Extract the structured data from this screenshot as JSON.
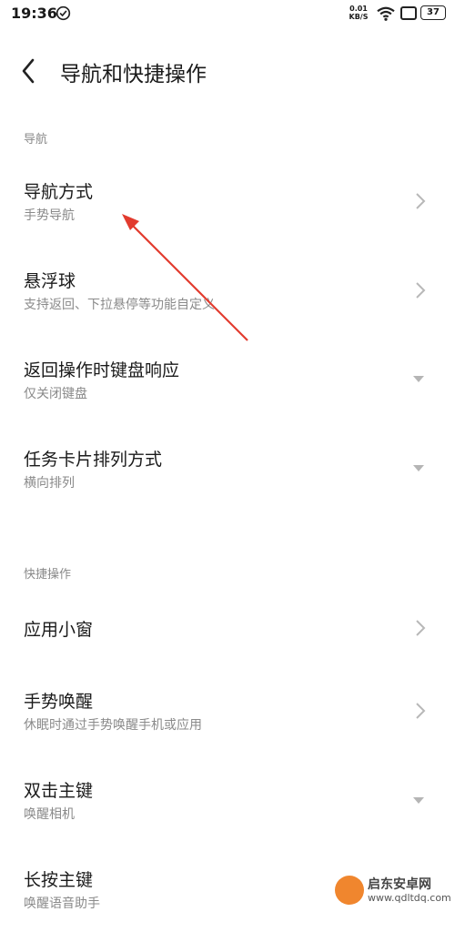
{
  "status": {
    "time": "19:36",
    "net_speed_value": "0.01",
    "net_speed_unit": "KB/S",
    "battery": "37",
    "icons": [
      "check-circle-icon",
      "wifi-icon",
      "window-icon",
      "battery-icon"
    ]
  },
  "header": {
    "back_icon": "chevron-left-icon",
    "title": "导航和快捷操作"
  },
  "sections": [
    {
      "label": "导航",
      "items": [
        {
          "title": "导航方式",
          "subtitle": "手势导航",
          "control": "chevron"
        },
        {
          "title": "悬浮球",
          "subtitle": "支持返回、下拉悬停等功能自定义",
          "control": "chevron"
        },
        {
          "title": "返回操作时键盘响应",
          "subtitle": "仅关闭键盘",
          "control": "dropdown"
        },
        {
          "title": "任务卡片排列方式",
          "subtitle": "横向排列",
          "control": "dropdown"
        }
      ]
    },
    {
      "label": "快捷操作",
      "items": [
        {
          "title": "应用小窗",
          "subtitle": "",
          "control": "chevron"
        },
        {
          "title": "手势唤醒",
          "subtitle": "休眠时通过手势唤醒手机或应用",
          "control": "chevron"
        },
        {
          "title": "双击主键",
          "subtitle": "唤醒相机",
          "control": "dropdown"
        },
        {
          "title": "长按主键",
          "subtitle": "唤醒语音助手",
          "control": "dropdown"
        }
      ]
    }
  ],
  "watermark": {
    "title": "启东安卓网",
    "url": "www.qdltdq.com"
  },
  "colors": {
    "annotation_arrow": "#e23b2e",
    "background": "#ffffff"
  }
}
